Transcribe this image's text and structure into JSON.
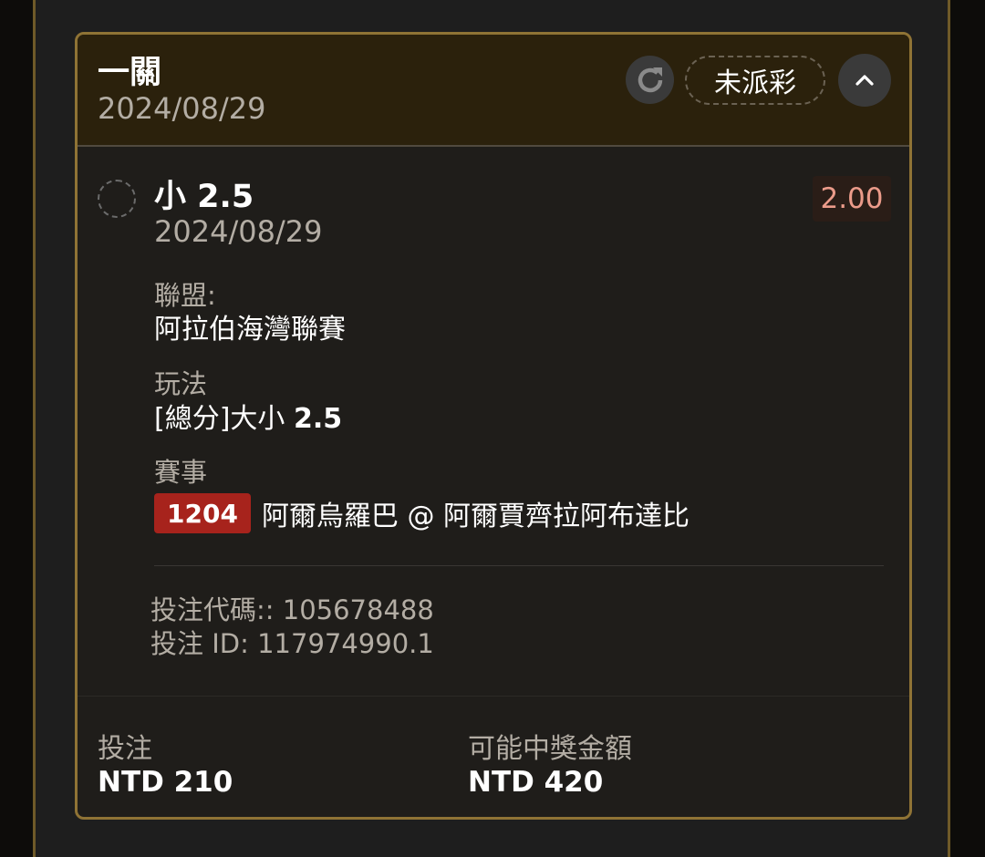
{
  "bet": {
    "type": "一關",
    "date": "2024/08/29",
    "status": "未派彩",
    "refresh_icon": "refresh-icon",
    "collapse_icon": "chevron-up-icon"
  },
  "selection": {
    "name": "小 2.5",
    "date": "2024/08/29",
    "odds": "2.00",
    "league_label": "聯盟:",
    "league_value": "阿拉伯海灣聯賽",
    "market_label": "玩法",
    "market_prefix": "[總分]大小 ",
    "market_line": "2.5",
    "event_label": "賽事",
    "match_number": "1204",
    "match_name": "阿爾烏羅巴 @ 阿爾賈齊拉阿布達比"
  },
  "ticket": {
    "code_line": "投注代碼:: 105678488",
    "id_line": "投注 ID: 117974990.1"
  },
  "footer": {
    "stake_label": "投注",
    "stake_value": "NTD 210",
    "payout_label": "可能中獎金額",
    "payout_value": "NTD 420"
  },
  "colors": {
    "header_bg": "#2b210c",
    "card_border": "#8f7335",
    "odds_text": "#eb9b8a",
    "match_badge": "#a7231c"
  }
}
